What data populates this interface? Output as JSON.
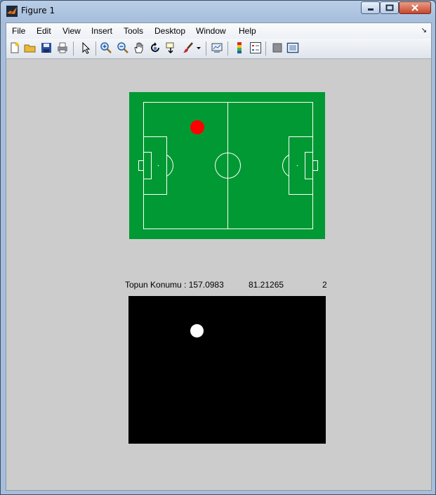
{
  "window": {
    "title": "Figure 1",
    "buttons": [
      "minimize-icon",
      "maximize-icon",
      "close-icon"
    ]
  },
  "menu": {
    "items": [
      "File",
      "Edit",
      "View",
      "Insert",
      "Tools",
      "Desktop",
      "Window",
      "Help"
    ],
    "dock_glyph": "↘"
  },
  "toolbar": {
    "tools": [
      "new-figure-icon",
      "open-file-icon",
      "save-figure-icon",
      "print-figure-icon",
      "edit-plot-icon",
      "zoom-in-icon",
      "zoom-out-icon",
      "pan-icon",
      "rotate-3d-icon",
      "data-cursor-icon",
      "brush-icon",
      "link-plot-icon",
      "insert-colorbar-icon",
      "insert-legend-icon",
      "hide-plot-tools-icon",
      "show-plot-tools-icon"
    ]
  },
  "colors": {
    "pitch_green": "#009933",
    "ball_red": "#ff0000",
    "figure_bg": "#cccccc"
  },
  "axes_title": {
    "label": "Topun Konumu : 157.0983",
    "y_value": "81.21265",
    "count": "2"
  }
}
